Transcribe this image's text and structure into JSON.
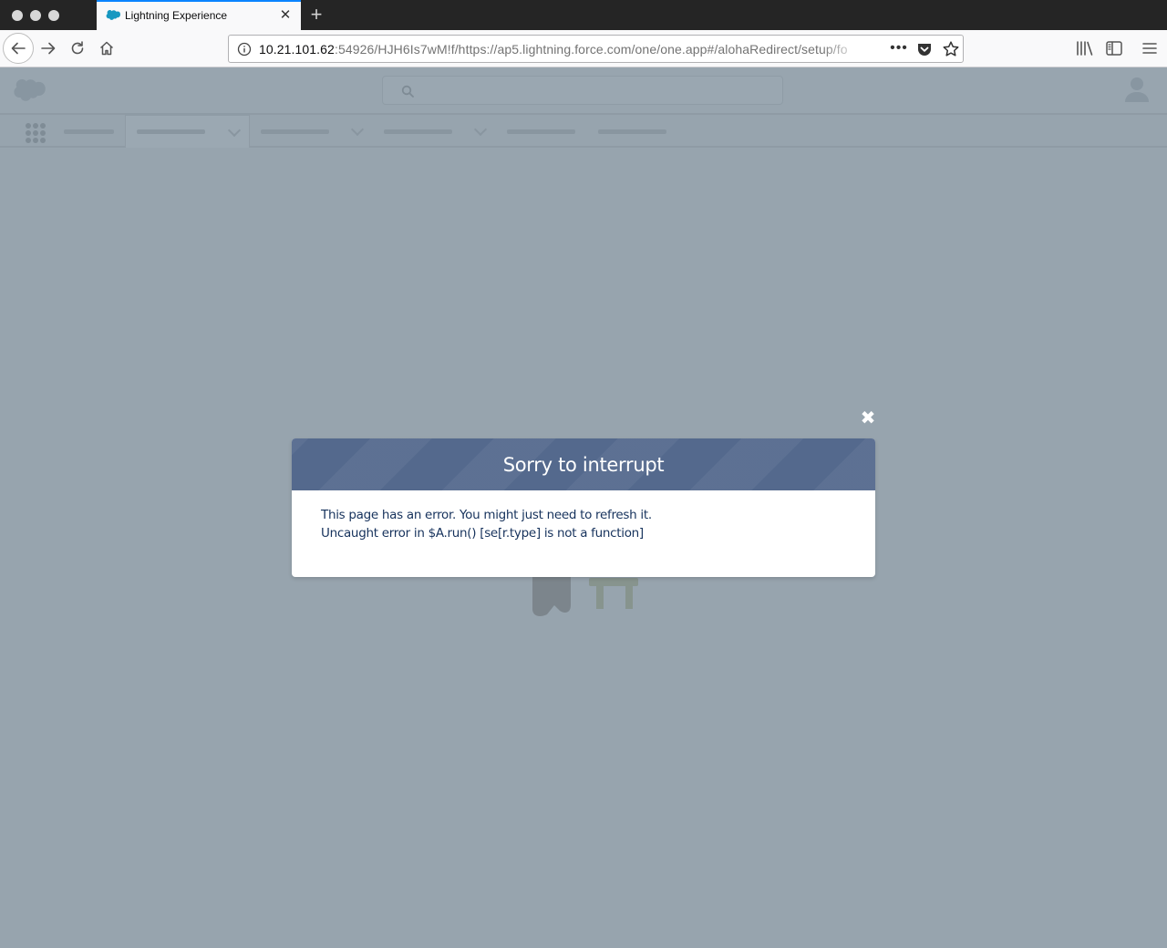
{
  "browser": {
    "tab": {
      "title": "Lightning Experience",
      "close_glyph": "✕"
    },
    "new_tab_glyph": "+",
    "url": {
      "host": "10.21.101.62",
      "rest": ":54926/HJH6Is7wM!f/https://ap5.lightning.force.com/one/one.app#/alohaRedirect/setup/fo"
    },
    "more_glyph": "•••",
    "icons": [
      "back-arrow-icon",
      "forward-arrow-icon",
      "reload-icon",
      "home-icon",
      "info-icon",
      "pocket-icon",
      "star-icon",
      "library-icon",
      "sidebar-icon",
      "menu-icon"
    ]
  },
  "salesforce": {
    "icons": [
      "salesforce-cloud-icon",
      "search-icon",
      "avatar-icon",
      "app-launcher-icon"
    ]
  },
  "modal": {
    "close_glyph": "✖",
    "title": "Sorry to interrupt",
    "message_line1": "This page has an error. You might just need to refresh it.",
    "message_line2": "Uncaught error in $A.run() [se[r.type] is not a function]"
  },
  "colors": {
    "modal_header": "#54698d",
    "overlay": "#97a4ae",
    "tab_accent": "#0a84ff",
    "modal_text": "#16325c"
  }
}
